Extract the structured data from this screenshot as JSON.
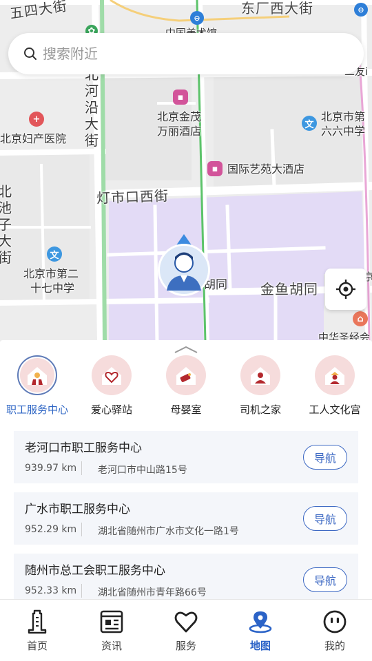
{
  "search": {
    "placeholder": "搜索附近"
  },
  "map": {
    "streets": {
      "wusi": "五四大街",
      "dongchang_top": "东厂西大街",
      "dengshikou": "灯市口西街",
      "jinyu": "金鱼胡同",
      "hutong_partial": "胡同",
      "beiheyan": "北河沿大街",
      "left_vertical": "北池子大街",
      "top_partial": "中国美术馆",
      "right_partial_1": "二友i",
      "right_partial_2": "京",
      "bottom_partial": "中华圣经会"
    },
    "pois": [
      {
        "name": "北京妇产医院",
        "icon": "hospital-icon"
      },
      {
        "name_line1": "北京金茂",
        "name_line2": "万丽酒店",
        "icon": "hotel-icon"
      },
      {
        "name": "国际艺苑大酒店",
        "icon": "hotel-icon"
      },
      {
        "name_line1": "北京市第",
        "name_line2": "六六中学",
        "icon": "school-icon"
      },
      {
        "name_line1": "北京市第二",
        "name_line2": "十七中学",
        "icon": "school-icon"
      }
    ],
    "colors": {
      "park": "#e3dbf6",
      "road": "#ffffff",
      "green_road": "#9fdca8",
      "pink_road": "#e9a6d6",
      "yellow_road": "#f5cf7a"
    }
  },
  "categories": [
    {
      "label": "职工服务中心",
      "selected": true
    },
    {
      "label": "爱心驿站",
      "selected": false
    },
    {
      "label": "母婴室",
      "selected": false
    },
    {
      "label": "司机之家",
      "selected": false
    },
    {
      "label": "工人文化宫",
      "selected": false
    }
  ],
  "results": [
    {
      "title": "老河口市职工服务中心",
      "distance": "939.97 km",
      "address": "老河口市中山路15号",
      "nav_label": "导航"
    },
    {
      "title": "广水市职工服务中心",
      "distance": "952.29 km",
      "address": "湖北省随州市广水市文化一路1号",
      "nav_label": "导航"
    },
    {
      "title": "随州市总工会职工服务中心",
      "distance": "952.33 km",
      "address": "湖北省随州市青年路66号",
      "nav_label": "导航"
    }
  ],
  "tabs": [
    {
      "label": "首页",
      "icon": "home-tower-icon",
      "active": false
    },
    {
      "label": "资讯",
      "icon": "news-icon",
      "active": false
    },
    {
      "label": "服务",
      "icon": "heart-icon",
      "active": false
    },
    {
      "label": "地图",
      "icon": "map-pin-icon",
      "active": true
    },
    {
      "label": "我的",
      "icon": "smiley-icon",
      "active": false
    }
  ],
  "accent_color": "#2b63c7"
}
